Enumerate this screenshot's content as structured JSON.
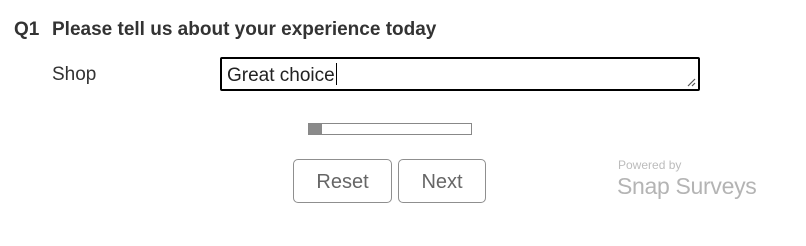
{
  "question": {
    "number": "Q1",
    "text": "Please tell us about your experience today"
  },
  "field": {
    "label": "Shop",
    "value": "Great choice"
  },
  "progress": {
    "fraction": 0.08,
    "fill_color": "#8a8a8a"
  },
  "buttons": {
    "reset_label": "Reset",
    "next_label": "Next"
  },
  "branding": {
    "powered_by": "Powered by",
    "brand_part1": "Snap",
    "brand_part2": "Surveys"
  },
  "icons": {
    "resize": "resize-grip-icon"
  }
}
